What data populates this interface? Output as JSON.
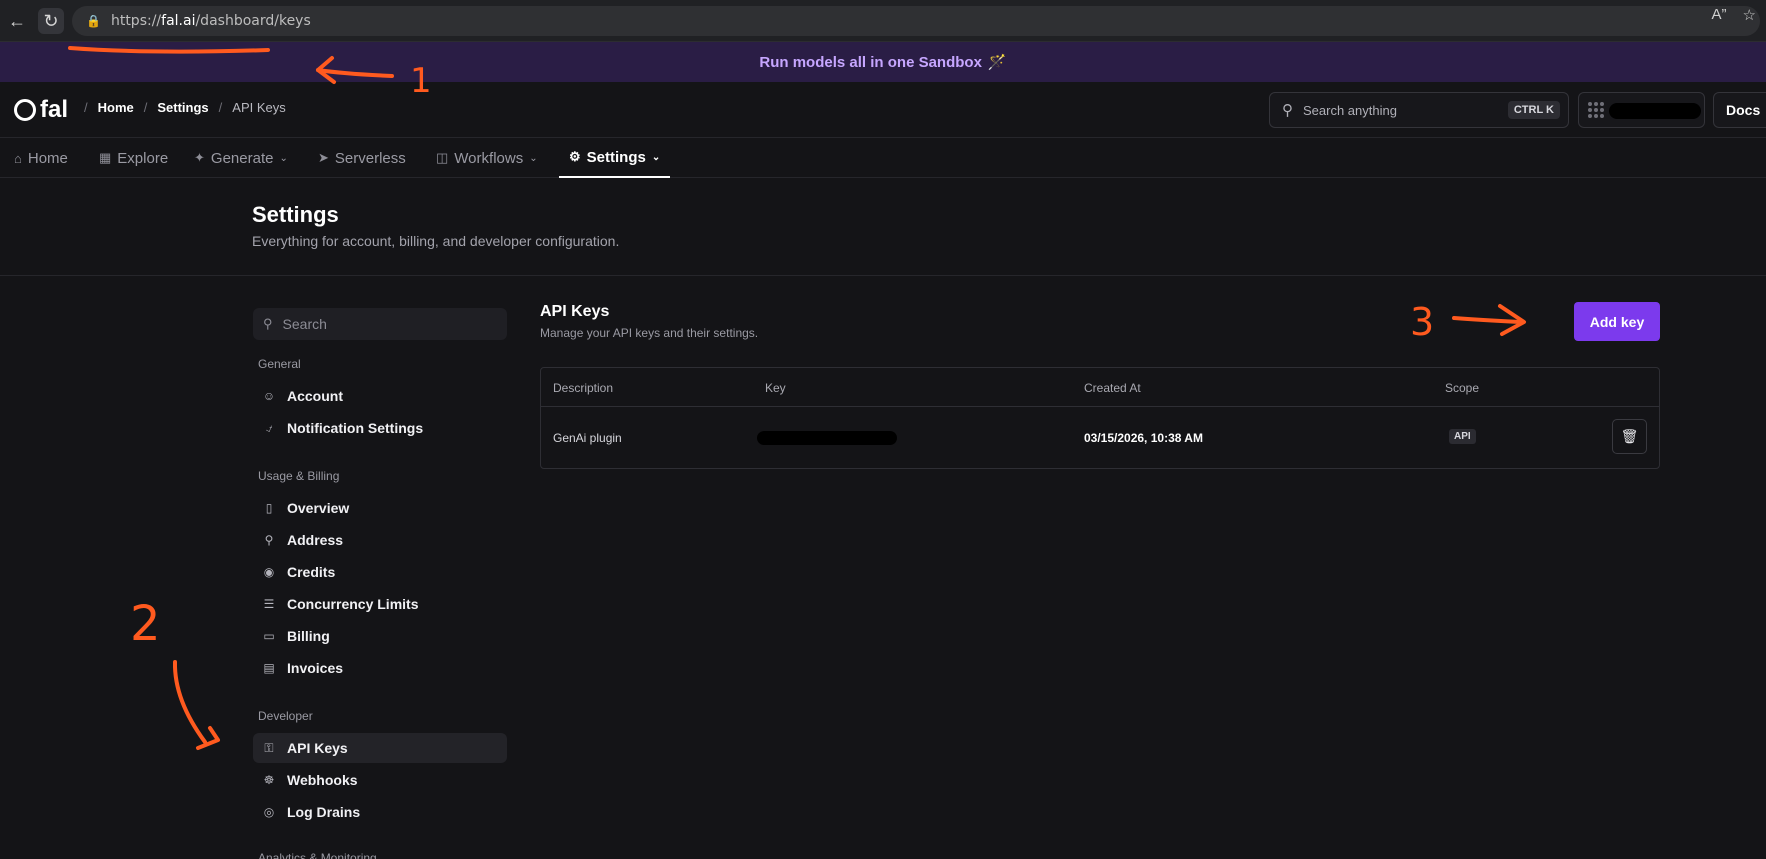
{
  "browser": {
    "url_scheme": "https://",
    "url_host": "fal.ai",
    "url_path": "/dashboard/keys"
  },
  "banner": {
    "text": "Run models all in one Sandbox",
    "emoji": "🪄"
  },
  "header": {
    "logo_text": "fal",
    "breadcrumbs": [
      "Home",
      "Settings",
      "API Keys"
    ],
    "search_placeholder": "Search anything",
    "search_shortcut": "CTRL K",
    "docs_label": "Docs"
  },
  "tabs": [
    {
      "label": "Home",
      "icon": "home-icon"
    },
    {
      "label": "Explore",
      "icon": "grid-icon"
    },
    {
      "label": "Generate",
      "icon": "wand-icon"
    },
    {
      "label": "Serverless",
      "icon": "rocket-icon"
    },
    {
      "label": "Workflows",
      "icon": "workflow-icon"
    },
    {
      "label": "Settings",
      "icon": "gear-icon"
    }
  ],
  "page": {
    "title": "Settings",
    "subtitle": "Everything for account, billing, and developer configuration."
  },
  "sidebar": {
    "search_placeholder": "Search",
    "groups": {
      "general": "General",
      "usage": "Usage & Billing",
      "developer": "Developer",
      "analytics": "Analytics & Monitoring"
    },
    "items": {
      "account": "Account",
      "notifications": "Notification Settings",
      "overview": "Overview",
      "address": "Address",
      "credits": "Credits",
      "concurrency": "Concurrency Limits",
      "billing": "Billing",
      "invoices": "Invoices",
      "api_keys": "API Keys",
      "webhooks": "Webhooks",
      "log_drains": "Log Drains"
    }
  },
  "api_keys": {
    "title": "API Keys",
    "subtitle": "Manage your API keys and their settings.",
    "add_label": "Add key",
    "columns": [
      "Description",
      "Key",
      "Created At",
      "Scope"
    ],
    "rows": [
      {
        "description": "GenAi plugin",
        "created_at": "03/15/2026, 10:38 AM",
        "scope": "API"
      }
    ]
  },
  "annotations": {
    "one": "1",
    "two": "2",
    "three": "3",
    "color": "#ff5a1f"
  }
}
